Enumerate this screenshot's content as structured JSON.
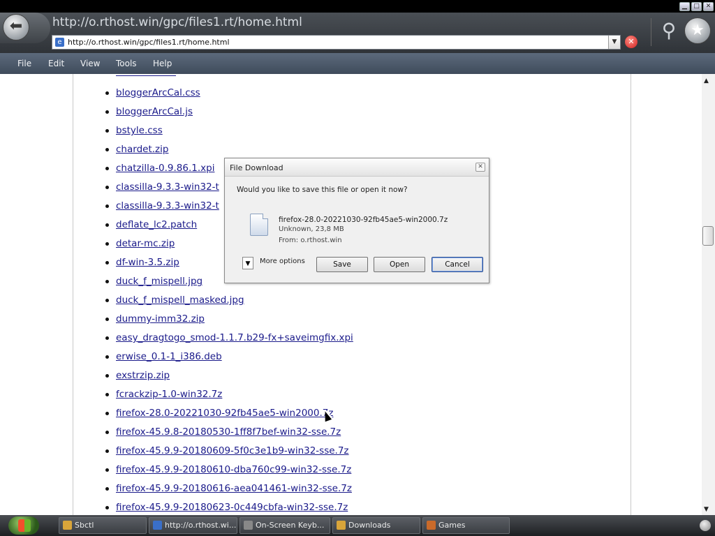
{
  "browser": {
    "page_title": "http://o.rthost.win/gpc/files1.rt/home.html",
    "address": "http://o.rthost.win/gpc/files1.rt/home.html"
  },
  "menu": [
    "File",
    "Edit",
    "View",
    "Tools",
    "Help"
  ],
  "files": [
    "bloggerArcCal.css",
    "bloggerArcCal.js",
    "bstyle.css",
    "chardet.zip",
    "chatzilla-0.9.86.1.xpi",
    "classilla-9.3.3-win32-t",
    "classilla-9.3.3-win32-t",
    "deflate_lc2.patch",
    "detar-mc.zip",
    "df-win-3.5.zip",
    "duck_f_mispell.jpg",
    "duck_f_mispell_masked.jpg",
    "dummy-imm32.zip",
    "easy_dragtogo_smod-1.1.7.b29-fx+saveimgfix.xpi",
    "erwise_0.1-1_i386.deb",
    "exstrzip.zip",
    "fcrackzip-1.0-win32.7z",
    "firefox-28.0-20221030-92fb45ae5-win2000.7z",
    "firefox-45.9.8-20180530-1ff8f7bef-win32-sse.7z",
    "firefox-45.9.9-20180609-5f0c3e1b9-win32-sse.7z",
    "firefox-45.9.9-20180610-dba760c99-win32-sse.7z",
    "firefox-45.9.9-20180616-aea041461-win32-sse.7z",
    "firefox-45.9.9-20180623-0c449cbfa-win32-sse.7z"
  ],
  "dialog": {
    "title": "File Download",
    "question": "Would you like to save this file or open it now?",
    "filename": "firefox-28.0-20221030-92fb45ae5-win2000.7z",
    "type_size": "Unknown, 23,8 MB",
    "from": "From:  o.rthost.win",
    "more_options": "More options",
    "save": "Save",
    "open": "Open",
    "cancel": "Cancel"
  },
  "taskbar": [
    {
      "label": "Sbctl",
      "icon": "folder-icon",
      "color": "#d9a53a"
    },
    {
      "label": "http://o.rthost.wi...",
      "icon": "browser-icon",
      "color": "#3a6fc8"
    },
    {
      "label": "On-Screen Keyb...",
      "icon": "keyboard-icon",
      "color": "#888888"
    },
    {
      "label": "Downloads",
      "icon": "folder-icon",
      "color": "#d9a53a"
    },
    {
      "label": "Games",
      "icon": "games-icon",
      "color": "#c96a2a"
    }
  ]
}
